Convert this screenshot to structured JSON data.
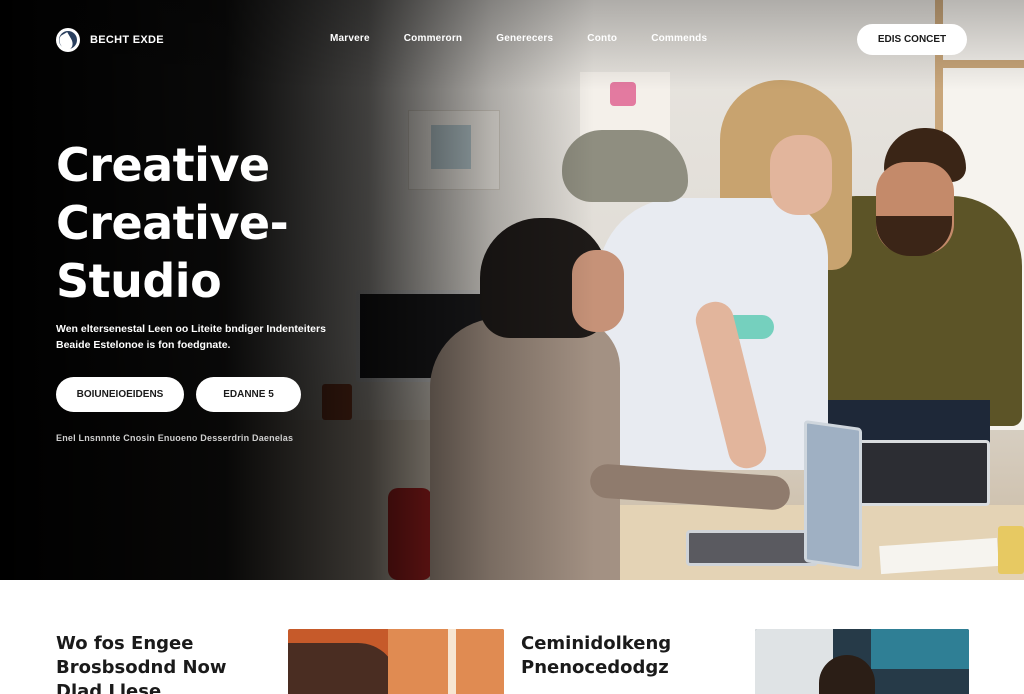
{
  "nav": {
    "logo_text": "BECHT EXDE",
    "links": [
      "Marvere",
      "Commerorn",
      "Generecers",
      "Conto",
      "Commends"
    ],
    "cta_label": "EDIS CONCET"
  },
  "hero": {
    "title_lines": [
      "Creative",
      "Creative-",
      "Studio"
    ],
    "description_lines": [
      "Wen eltersenestal Leen oo Liteite bndiger Indenteiters",
      "Beaide Estelonoe is fon foedgnate."
    ],
    "primary_button": "BOIUNEIOEIDENS",
    "secondary_button": "EDANNE 5",
    "caption": "Enel Lnsnnnte Cnosin Enuoeno Desserdrin Daenelas"
  },
  "section": {
    "col1_heading": [
      "Wo fos Engee",
      "Brosbsodnd Now",
      "Dlad Llese"
    ],
    "col2_heading": [
      "Ceminidolkeng",
      "Pnenocedodgz"
    ]
  },
  "colors": {
    "hero_overlay": "#000000",
    "button_bg": "#ffffff",
    "text_dark": "#1a1a1a"
  },
  "icons": {
    "logo": "studio-logo-icon"
  }
}
